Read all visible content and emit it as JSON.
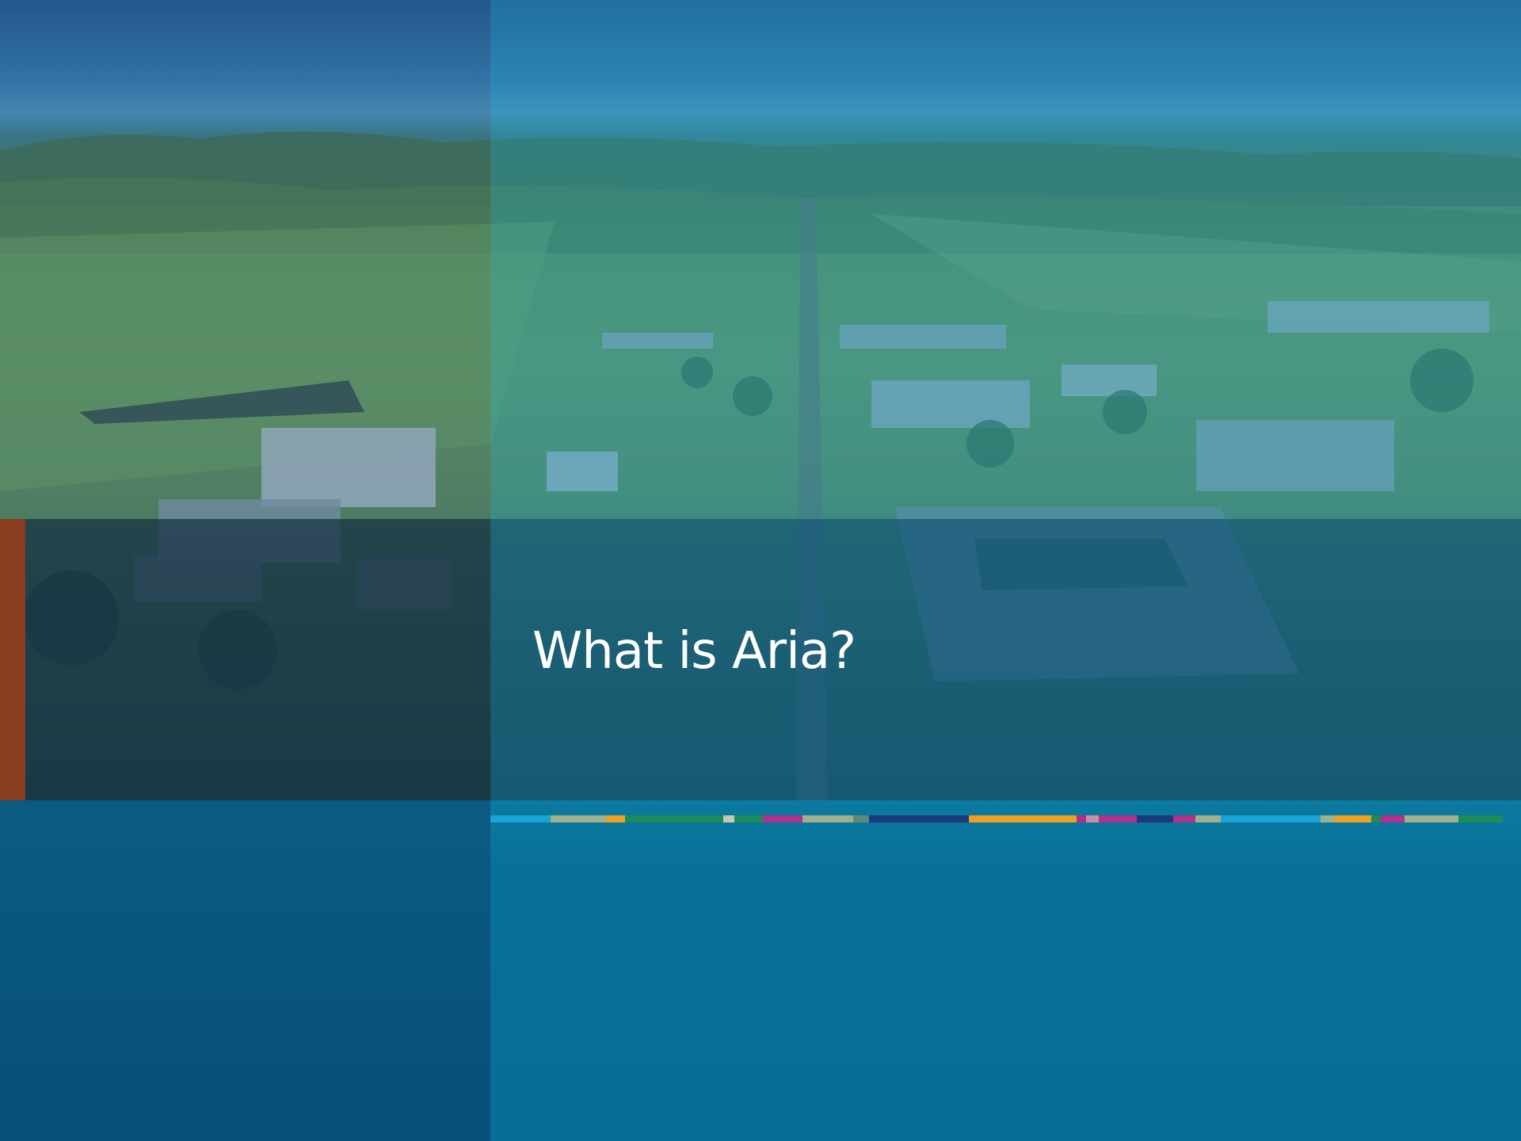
{
  "slide": {
    "title": "What is Aria?"
  },
  "colors": {
    "accent_bar": "#8a3d1e",
    "band_left": "#123048",
    "band_right": "#0e5880",
    "bottom_left": "#065079",
    "bottom_right": "#0a7097",
    "title_text": "#ffffff"
  },
  "color_strip": [
    {
      "color": "#1aa3d4"
    },
    {
      "color": "#9fb08a"
    },
    {
      "color": "#f0a020"
    },
    {
      "color": "#1f8a5a"
    },
    {
      "color": "#c8c8b0"
    },
    {
      "color": "#1f8a5a"
    },
    {
      "color": "#b0308a"
    },
    {
      "color": "#9fb08a"
    },
    {
      "color": "#5f8a7a"
    },
    {
      "color": "#1a3a7a"
    },
    {
      "color": "#f0a020"
    },
    {
      "color": "#b0308a"
    },
    {
      "color": "#c890a0"
    },
    {
      "color": "#b0308a"
    },
    {
      "color": "#1a3a7a"
    },
    {
      "color": "#b0308a"
    },
    {
      "color": "#9fb08a"
    },
    {
      "color": "#1aa3d4"
    },
    {
      "color": "#9fb08a"
    },
    {
      "color": "#f0a020"
    },
    {
      "color": "#1f8a5a"
    },
    {
      "color": "#b0308a"
    },
    {
      "color": "#9fb08a"
    },
    {
      "color": "#1f8a5a"
    }
  ]
}
